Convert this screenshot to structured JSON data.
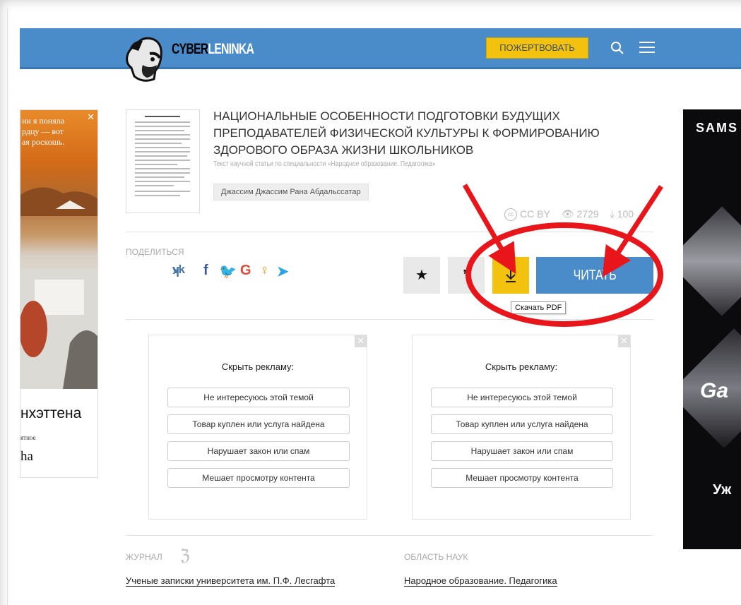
{
  "header": {
    "logo_part1": "CYBER",
    "logo_part2": "LENINKA",
    "donate_label": "ПОЖЕРТВОВАТЬ"
  },
  "article": {
    "title": "НАЦИОНАЛЬНЫЕ ОСОБЕННОСТИ ПОДГОТОВКИ БУДУЩИХ ПРЕПОДАВАТЕЛЕЙ ФИЗИЧЕСКОЙ КУЛЬТУРЫ К ФОРМИРОВАНИЮ ЗДОРОВОГО ОБРАЗА ЖИЗНИ ШКОЛЬНИКОВ",
    "subtitle": "Текст научной статьи по специальности «Народное образование. Педагогика»",
    "author": "Джассим Джассим Рана Абдальссатар",
    "license": "CC BY",
    "views": "2729",
    "downloads": "100"
  },
  "share": {
    "label": "ПОДЕЛИТЬСЯ",
    "icons": [
      "vk-icon",
      "facebook-icon",
      "twitter-icon",
      "google-icon",
      "odnoklassniki-icon",
      "telegram-icon"
    ]
  },
  "actions": {
    "read_label": "ЧИТАТЬ",
    "pdf_tooltip": "Скачать PDF"
  },
  "ad_hide": {
    "heading": "Скрыть рекламу:",
    "options": [
      "Не интересуюсь этой темой",
      "Товар куплен или услуга найдена",
      "Нарушает закон или спам",
      "Мешает просмотру контента"
    ]
  },
  "left_ad": {
    "top_text_lines": [
      "ии я поняла",
      "рдцу — вот",
      "ая роскошь."
    ],
    "big_text": "нхэттена",
    "small_text": "ятное",
    "brand_text": "ha"
  },
  "right_ad": {
    "brand": "SAMS",
    "word": "Ga",
    "bottom": "Уж"
  },
  "footer": {
    "journal_label": "ЖУРНАЛ",
    "journal_name": "Ученые записки университета им. П.Ф. Лесгафта",
    "field_label": "ОБЛАСТЬ НАУК",
    "field_name": "Народное образование. Педагогика"
  },
  "colors": {
    "header_blue": "#4a8cca",
    "donate_yellow": "#f3c20e",
    "annotation_red": "#e8151b"
  }
}
